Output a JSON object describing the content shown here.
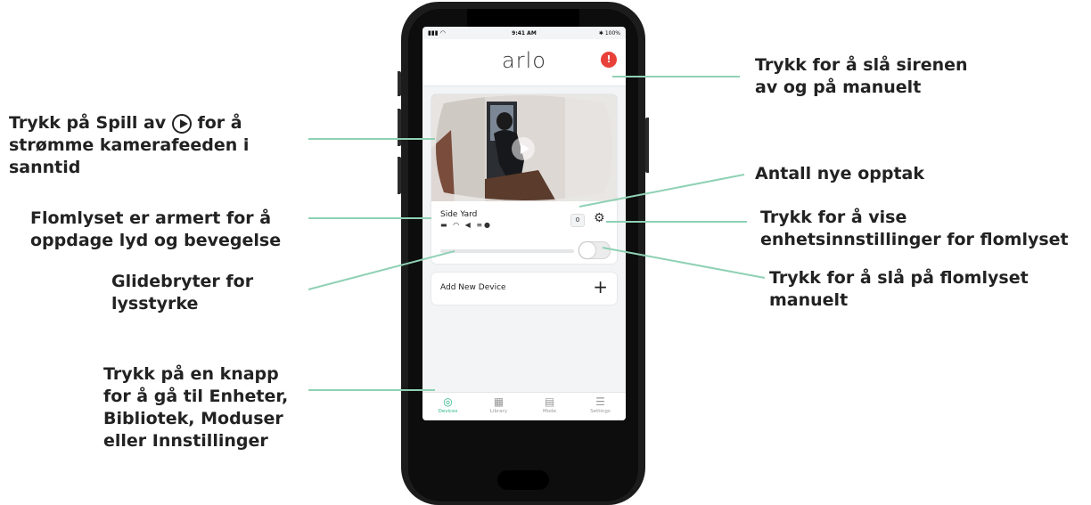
{
  "callouts": {
    "siren": [
      "Trykk for å slå sirenen",
      "av og på manuelt"
    ],
    "play": [
      "Trykk på Spill av",
      "for å",
      "strømme kamerafeeden i",
      "sanntid"
    ],
    "new_recordings": [
      "Antall nye opptak"
    ],
    "armed": [
      "Flomlyset er armert for å",
      "oppdage lyd og bevegelse"
    ],
    "settings": [
      "Trykk for å vise",
      "enhetsinnstillinger for flomlyset"
    ],
    "toggle": [
      "Trykk for å slå på flomlyset",
      "manuelt"
    ],
    "brightness": [
      "Glidebryter for",
      "lysstyrke"
    ],
    "tabs": [
      "Trykk på en knapp",
      "for å gå til Enheter,",
      "Bibliotek, Moduser",
      "eller Innstillinger"
    ]
  },
  "phone": {
    "status_time": "9:41 AM",
    "status_battery": "✱ 100%",
    "logo": "arlo",
    "device_name": "Side Yard",
    "new_recordings_count": "0",
    "brightness_level": 0.0,
    "light_on": false,
    "add_device_label": "Add New Device",
    "tabs": [
      {
        "label": "Devices",
        "icon": "devices-icon",
        "active": true
      },
      {
        "label": "Library",
        "icon": "library-icon",
        "active": false
      },
      {
        "label": "Mode",
        "icon": "mode-icon",
        "active": false
      },
      {
        "label": "Settings",
        "icon": "settings-menu-icon",
        "active": false
      }
    ]
  },
  "colors": {
    "leader_line": "#8fd1b4",
    "accent": "#2fb78d",
    "siren": "#e8413a"
  }
}
